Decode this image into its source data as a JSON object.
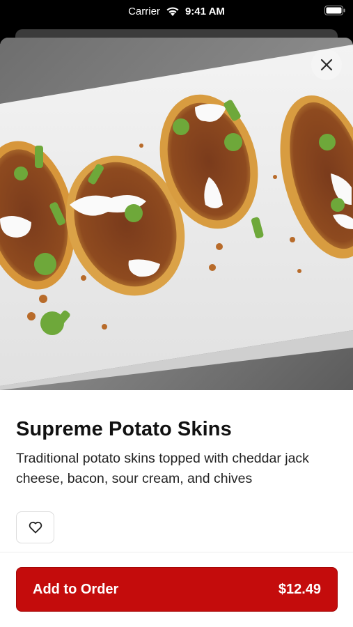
{
  "status_bar": {
    "carrier": "Carrier",
    "time": "9:41 AM"
  },
  "item": {
    "title": "Supreme Potato Skins",
    "description": "Traditional potato skins topped with cheddar jack cheese, bacon, sour cream, and chives",
    "image": "food-photo-potato-skins"
  },
  "actions": {
    "close_icon": "close-icon",
    "favorite_icon": "heart-icon",
    "add_to_order_label": "Add to Order",
    "price": "$12.49"
  },
  "colors": {
    "accent": "#c40c0c",
    "text": "#111111"
  }
}
